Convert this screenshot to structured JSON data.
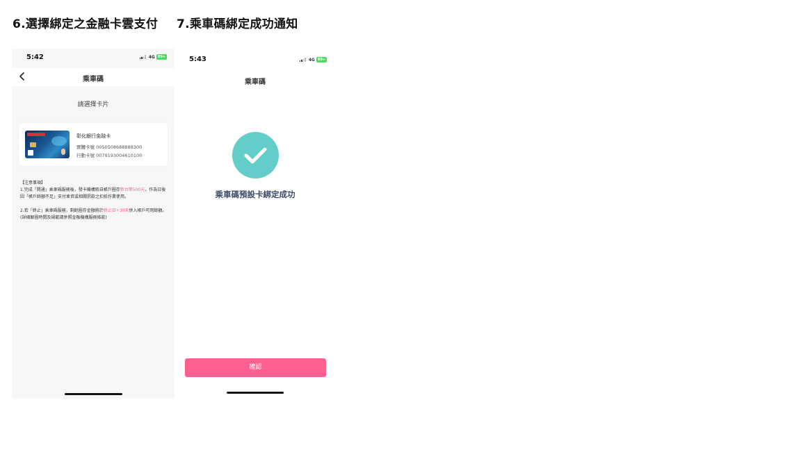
{
  "headings": {
    "step6": "6.選擇綁定之金融卡雲支付",
    "step7": "7.乘車碼綁定成功通知"
  },
  "screen1": {
    "status": {
      "time": "5:42",
      "network": "4G",
      "battery": "89+"
    },
    "nav": {
      "title": "乘車碼",
      "back_icon": "chevron-left-icon"
    },
    "section_label": "請選擇卡片",
    "card": {
      "name": "彰化銀行金融卡",
      "physical_label": "實體卡號",
      "physical_number": "0050508688888300",
      "mobile_label": "行動卡號",
      "mobile_number": "0079193004610100"
    },
    "notes": {
      "title": "【注意事項】",
      "item1_pre": "1.完成「開通」乘車碼服務後，發卡機構將自帳戶圈存",
      "item1_highlight": "新台幣500元",
      "item1_post": "，作為日後因「帳戶餘額不足」支付車資或相關罰款之扣抵作業使用。",
      "item2_pre": "2.若「終止」乘車碼服務，剩餘圈存金額將於",
      "item2_highlight": "終止日+30天",
      "item2_post": "併入帳戶可用餘額。(詳細解圈時間及規範請參照金融機構服務條款)"
    }
  },
  "screen2": {
    "status": {
      "time": "5:43",
      "network": "4G",
      "battery": "89+"
    },
    "nav": {
      "title": "乘車碼"
    },
    "success_message": "乘車碼預設卡綁定成功",
    "confirm_label": "確認",
    "success_icon": "check-circle-icon"
  },
  "colors": {
    "accent_pink": "#ff6090",
    "success_teal": "#63cdca",
    "highlight_text": "#ff5f8e",
    "battery_green": "#4cd964"
  }
}
